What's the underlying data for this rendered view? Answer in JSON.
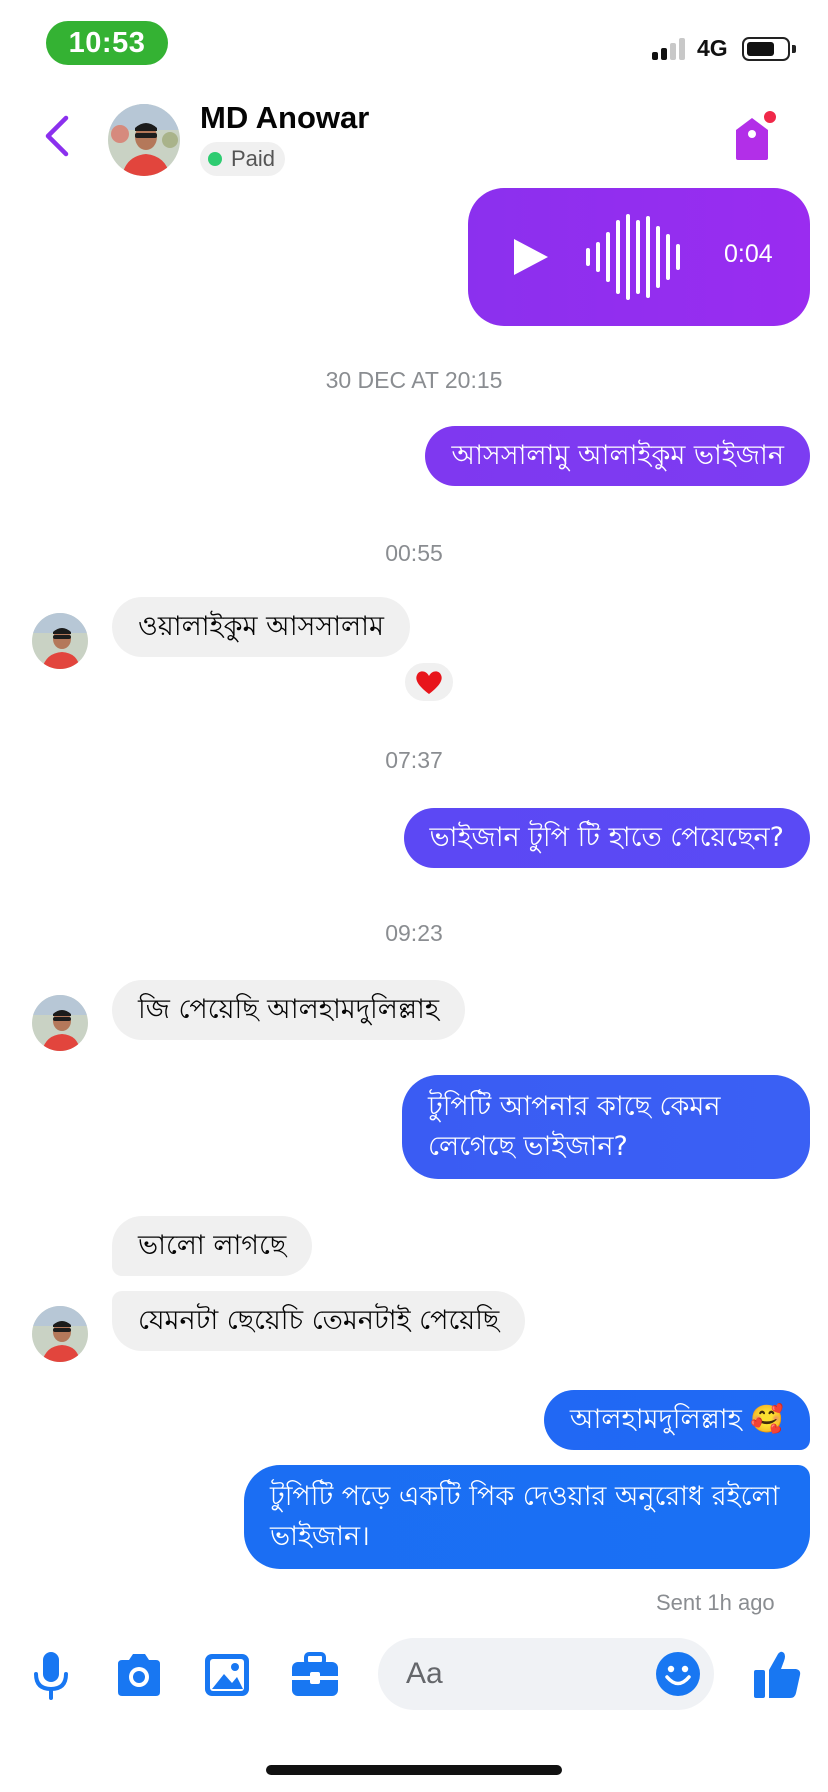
{
  "status_bar": {
    "time": "10:53",
    "network": "4G",
    "signal_bars": 2,
    "battery_level": 0.7
  },
  "header": {
    "contact_name": "MD Anowar",
    "status_label": "Paid",
    "status_color": "#2ecc71"
  },
  "colors": {
    "accent": "#8b30ee",
    "bubble_mid": "#5a45f5",
    "bubble_blue": "#1b6ef3",
    "incoming": "#f0f0f0"
  },
  "voice_message": {
    "duration": "0:04",
    "icon": "play-icon"
  },
  "timestamps": [
    "30 DEC AT 20:15",
    "00:55",
    "07:37",
    "09:23"
  ],
  "messages": [
    {
      "direction": "out",
      "text": "আসসালামু আলাইকুম ভাইজান"
    },
    {
      "direction": "in",
      "text": "ওয়ালাইকুম আসসালাম",
      "reaction": "❤️"
    },
    {
      "direction": "out",
      "text": "ভাইজান টুপি টি হাতে পেয়েছেন?"
    },
    {
      "direction": "in",
      "text": "জি পেয়েছি আলহামদুলিল্লাহ"
    },
    {
      "direction": "out",
      "text": "টুপিটি আপনার কাছে কেমন লেগেছে ভাইজান?"
    },
    {
      "direction": "in",
      "text": "ভালো লাগছে"
    },
    {
      "direction": "in",
      "text": "যেমনটা ছেয়েচি তেমনটাই পেয়েছি"
    },
    {
      "direction": "out",
      "text": "আলহামদুলিল্লাহ 🥰"
    },
    {
      "direction": "out",
      "text": "টুপিটি পড়ে একটি পিক দেওয়ার অনুরোধ রইলো ভাইজান।"
    }
  ],
  "sent_status": "Sent 1h ago",
  "composer": {
    "placeholder": "Aa",
    "icons": [
      "microphone-icon",
      "camera-icon",
      "gallery-icon",
      "toolbox-icon",
      "emoji-icon",
      "thumbs-up-icon"
    ]
  }
}
